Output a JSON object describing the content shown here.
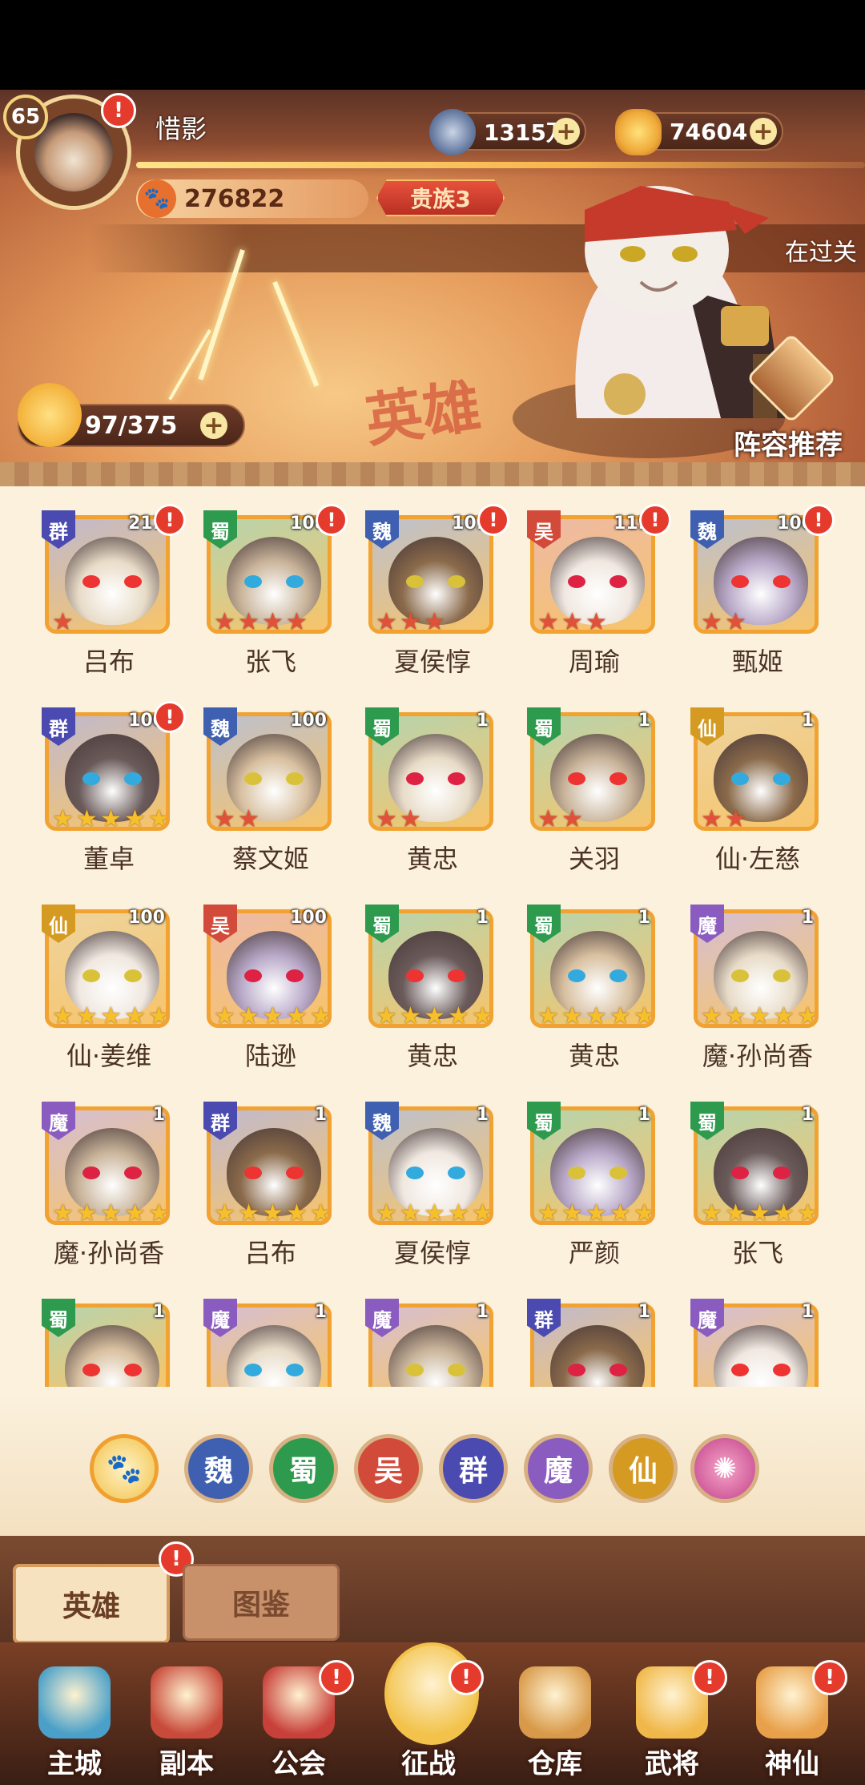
{
  "player": {
    "level": "65",
    "name": "惜影",
    "power": "276822",
    "noble": "贵族3"
  },
  "resources": {
    "coins": "1315万",
    "gold": "74604",
    "energy": "97/375"
  },
  "marquee": "在过关",
  "banner": {
    "hero_title": "英雄",
    "lineup_label": "阵容推荐"
  },
  "colors": {
    "wei": "#3f5fb0",
    "shu": "#2e9a4e",
    "wu": "#d24a3a",
    "qun": "#4a4ab0",
    "mo": "#8a5cc0",
    "xian": "#d49a22"
  },
  "heroes": [
    {
      "name": "吕布",
      "faction": "群",
      "level": "211",
      "stars": 1,
      "alert": true
    },
    {
      "name": "张飞",
      "faction": "蜀",
      "level": "108",
      "stars": 4,
      "alert": true
    },
    {
      "name": "夏侯惇",
      "faction": "魏",
      "level": "101",
      "stars": 3,
      "alert": true
    },
    {
      "name": "周瑜",
      "faction": "吴",
      "level": "119",
      "stars": 3,
      "alert": true
    },
    {
      "name": "甄姬",
      "faction": "魏",
      "level": "100",
      "stars": 2,
      "alert": true
    },
    {
      "name": "董卓",
      "faction": "群",
      "level": "100",
      "stars": 5,
      "alert": true
    },
    {
      "name": "蔡文姬",
      "faction": "魏",
      "level": "100",
      "stars": 2,
      "alert": false
    },
    {
      "name": "黄忠",
      "faction": "蜀",
      "level": "1",
      "stars": 2,
      "alert": false
    },
    {
      "name": "关羽",
      "faction": "蜀",
      "level": "1",
      "stars": 2,
      "alert": false
    },
    {
      "name": "仙·左慈",
      "faction": "仙",
      "level": "1",
      "stars": 2,
      "alert": false
    },
    {
      "name": "仙·姜维",
      "faction": "仙",
      "level": "100",
      "stars": 5,
      "alert": false
    },
    {
      "name": "陆逊",
      "faction": "吴",
      "level": "100",
      "stars": 5,
      "alert": false
    },
    {
      "name": "黄忠",
      "faction": "蜀",
      "level": "1",
      "stars": 5,
      "alert": false
    },
    {
      "name": "黄忠",
      "faction": "蜀",
      "level": "1",
      "stars": 5,
      "alert": false
    },
    {
      "name": "魔·孙尚香",
      "faction": "魔",
      "level": "1",
      "stars": 5,
      "alert": false
    },
    {
      "name": "魔·孙尚香",
      "faction": "魔",
      "level": "1",
      "stars": 5,
      "alert": false
    },
    {
      "name": "吕布",
      "faction": "群",
      "level": "1",
      "stars": 5,
      "alert": false
    },
    {
      "name": "夏侯惇",
      "faction": "魏",
      "level": "1",
      "stars": 5,
      "alert": false
    },
    {
      "name": "严颜",
      "faction": "蜀",
      "level": "1",
      "stars": 5,
      "alert": false
    },
    {
      "name": "张飞",
      "faction": "蜀",
      "level": "1",
      "stars": 5,
      "alert": false
    },
    {
      "name": "",
      "faction": "蜀",
      "level": "1",
      "stars": 0,
      "alert": false
    },
    {
      "name": "",
      "faction": "魔",
      "level": "1",
      "stars": 0,
      "alert": false
    },
    {
      "name": "",
      "faction": "魔",
      "level": "1",
      "stars": 0,
      "alert": false
    },
    {
      "name": "",
      "faction": "群",
      "level": "1",
      "stars": 0,
      "alert": false
    },
    {
      "name": "",
      "faction": "魔",
      "level": "1",
      "stars": 0,
      "alert": false
    }
  ],
  "filters": [
    "paw",
    "魏",
    "蜀",
    "吴",
    "群",
    "魔",
    "仙",
    "swirl"
  ],
  "tabs": {
    "hero": "英雄",
    "codex": "图鉴"
  },
  "nav": [
    {
      "label": "主城",
      "alert": false
    },
    {
      "label": "副本",
      "alert": false
    },
    {
      "label": "公会",
      "alert": true
    },
    {
      "label": "征战",
      "alert": true
    },
    {
      "label": "仓库",
      "alert": false
    },
    {
      "label": "武将",
      "alert": true
    },
    {
      "label": "神仙",
      "alert": true
    }
  ]
}
